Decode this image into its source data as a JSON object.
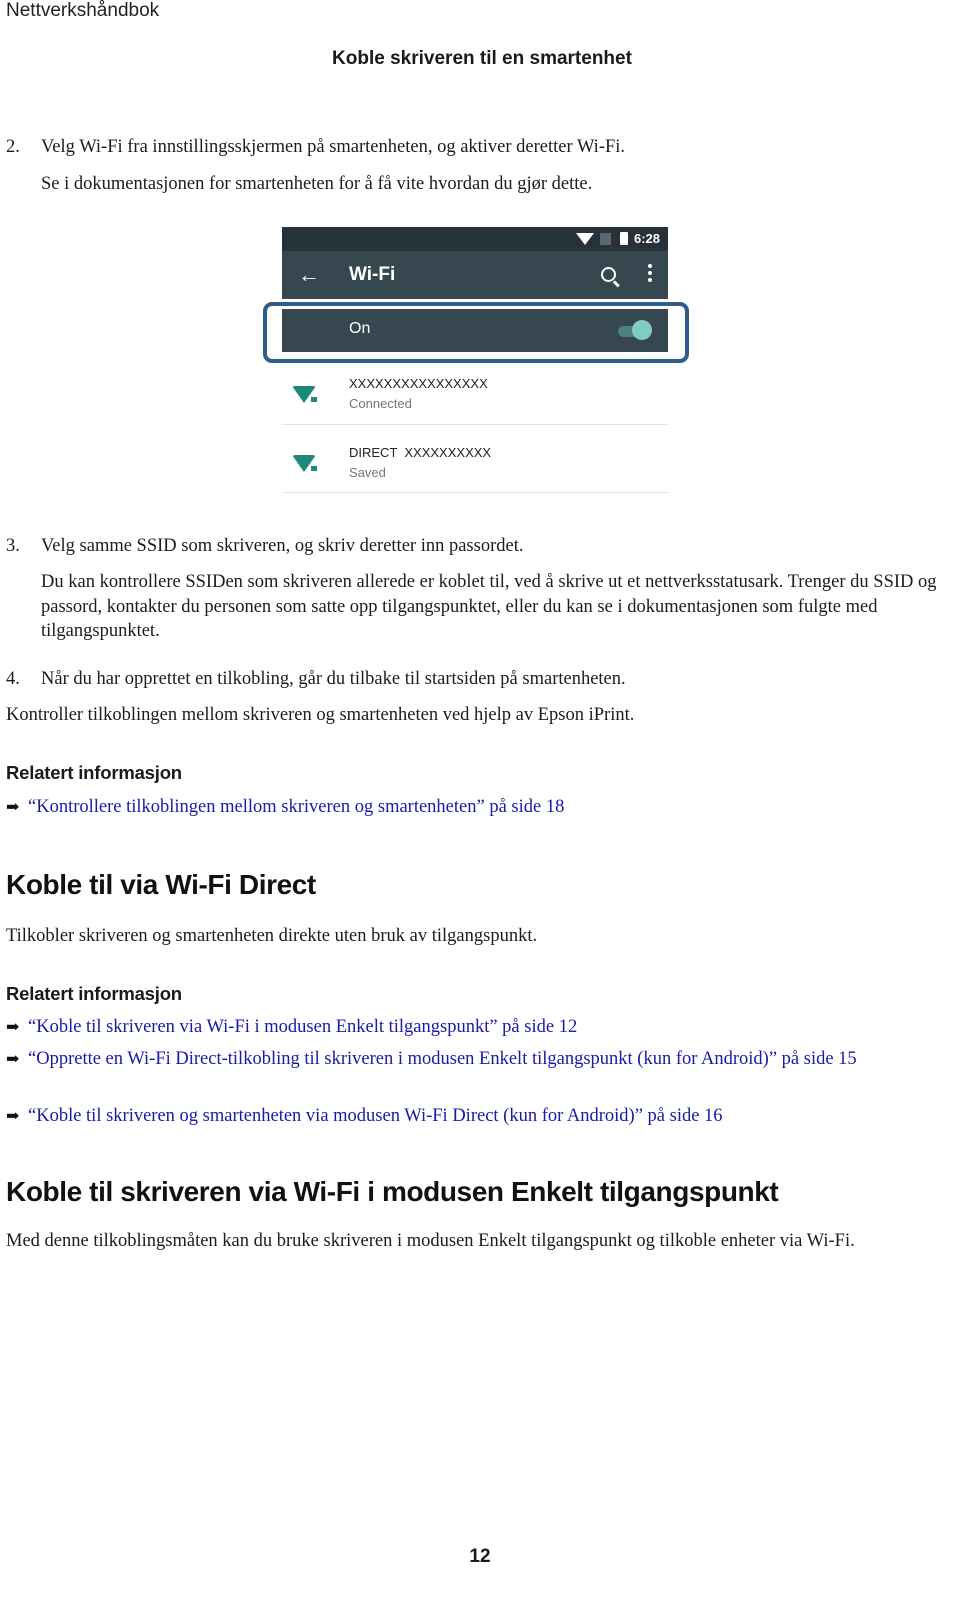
{
  "header": {
    "running_head": "Nettverkshåndbok",
    "chapter_title": "Koble skriveren til en smartenhet"
  },
  "steps": [
    {
      "number": "2.",
      "text": "Velg Wi-Fi fra innstillingsskjermen på smartenheten, og aktiver deretter Wi-Fi.",
      "note": "Se i dokumentasjonen for smartenheten for å få vite hvordan du gjør dette."
    },
    {
      "number": "3.",
      "text": "Velg samme SSID som skriveren, og skriv deretter inn passordet.",
      "note": "Du kan kontrollere SSIDen som skriveren allerede er koblet til, ved å skrive ut et nettverksstatusark. Trenger du SSID og passord, kontakter du personen som satte opp tilgangspunktet, eller du kan se i dokumentasjonen som fulgte med tilgangspunktet."
    },
    {
      "number": "4.",
      "text": "Når du har opprettet en tilkobling, går du tilbake til startsiden på smartenheten."
    }
  ],
  "phone_screenshot": {
    "status_bar": {
      "time": "6:28",
      "icons": [
        "wifi-icon",
        "no-sim-icon",
        "battery-icon"
      ]
    },
    "toolbar": {
      "back_icon": "←",
      "title": "Wi-Fi",
      "search_icon": "search-icon",
      "menu_icon": "more-vert-icon"
    },
    "wifi_toggle": {
      "label": "On",
      "state": "on",
      "accent_color": "#80cbc4"
    },
    "networks": [
      {
        "ssid": "XXXXXXXXXXXXXXXX",
        "status": "Connected"
      },
      {
        "ssid": "DIRECT  XXXXXXXXXX",
        "status": "Saved"
      }
    ],
    "highlight_color": "#2e5d8c"
  },
  "after_steps": "Kontroller tilkoblingen mellom skriveren og smartenheten ved hjelp av Epson iPrint.",
  "related1": {
    "heading": "Relatert informasjon",
    "links": [
      {
        "arrow": "➡",
        "text": "“Kontrollere tilkoblingen mellom skriveren og smartenheten” på side 18"
      }
    ]
  },
  "section_wifi_direct": {
    "heading": "Koble til via Wi-Fi Direct",
    "body": "Tilkobler skriveren og smartenheten direkte uten bruk av tilgangspunkt.",
    "related_heading": "Relatert informasjon",
    "links": [
      {
        "arrow": "➡",
        "text": "“Koble til skriveren via Wi-Fi i modusen Enkelt tilgangspunkt” på side 12"
      },
      {
        "arrow": "➡",
        "text": "“Opprette en Wi-Fi Direct-tilkobling til skriveren i modusen Enkelt tilgangspunkt (kun for Android)” på side 15"
      },
      {
        "arrow": "➡",
        "text": "“Koble til skriveren og smartenheten via modusen Wi-Fi Direct (kun for Android)” på side 16"
      }
    ]
  },
  "section_simple_ap": {
    "heading": "Koble til skriveren via Wi-Fi i modusen Enkelt tilgangspunkt",
    "body": "Med denne tilkoblingsmåten kan du bruke skriveren i modusen Enkelt tilgangspunkt og tilkoble enheter via Wi-Fi."
  },
  "footer": {
    "page_number": "12"
  },
  "colors": {
    "link": "#1a1aa8",
    "text": "#1c1c1c"
  }
}
